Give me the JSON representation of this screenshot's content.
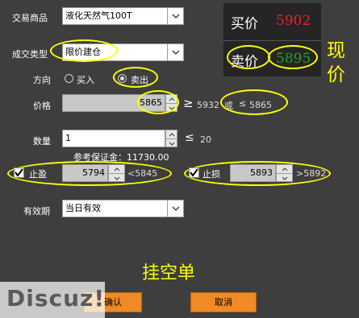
{
  "form": {
    "product_label": "交易商品",
    "product_value": "液化天然气100T",
    "type_label": "成交类型",
    "type_value": "限价建仓",
    "direction_label": "方向",
    "direction_buy": "买入",
    "direction_sell": "卖出",
    "direction_selected": "卖出",
    "price_label": "价格",
    "price_value": "5865",
    "price_ge_symbol": "≥",
    "price_ge": "5932",
    "price_or": "或",
    "price_le_symbol": "≤",
    "price_le": "5865",
    "qty_label": "数量",
    "qty_value": "1",
    "qty_le_symbol": "≤",
    "qty_max": "20",
    "margin_label": "参考保证金：",
    "margin_value": "11730.00",
    "stop_profit_label": "止盈",
    "stop_profit_value": "5794",
    "stop_profit_limit": "<5845",
    "stop_loss_label": "止损",
    "stop_loss_value": "5893",
    "stop_loss_limit": ">5892",
    "validity_label": "有效期",
    "validity_value": "当日有效"
  },
  "quote": {
    "buy_label": "买价",
    "buy_price": "5902",
    "sell_label": "卖价",
    "sell_price": "5895",
    "buy_color": "#e8202a",
    "sell_color": "#2aa02a"
  },
  "annotations": {
    "current_price": "现价",
    "pending_order": "挂空单"
  },
  "buttons": {
    "confirm": "确认",
    "cancel": "取消"
  },
  "watermark": "Discuz!",
  "colors": {
    "background": "#3e3e3e",
    "annotation": "#ffff00",
    "button": "#f08a24"
  }
}
